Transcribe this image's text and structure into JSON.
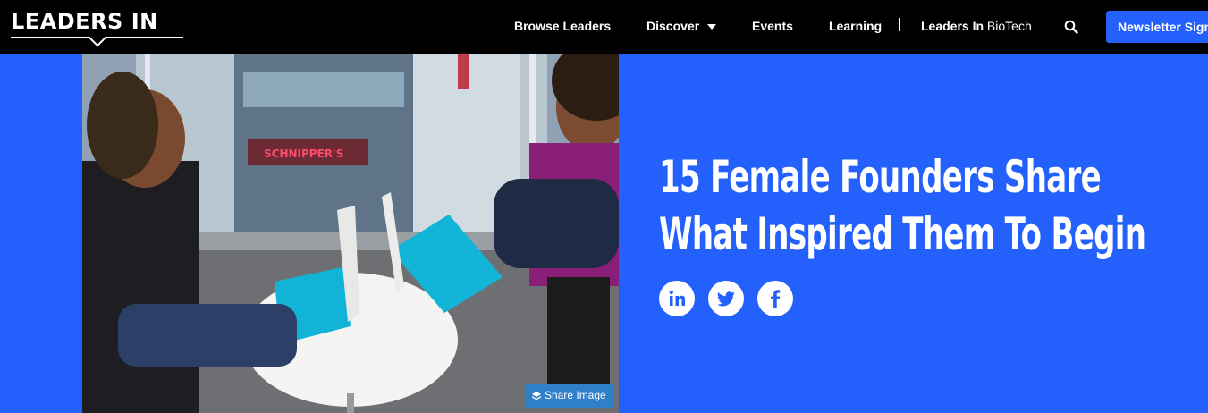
{
  "brand": {
    "logo_text": "LEADERS IN"
  },
  "nav": {
    "items": [
      {
        "label": "Browse Leaders"
      },
      {
        "label": "Discover",
        "icon": "chevron-down-icon"
      },
      {
        "label": "Events"
      },
      {
        "label": "Learning"
      }
    ],
    "biotech": {
      "bold": "Leaders In",
      "light": "BioTech"
    },
    "search_icon": "search-icon",
    "newsletter_label": "Newsletter Signup"
  },
  "hero": {
    "share_image_label": "Share Image",
    "share_icon": "layers-icon",
    "headline": "15 Female Founders Share What Inspired Them To Begin",
    "social": [
      "linkedin-icon",
      "twitter-icon",
      "facebook-icon"
    ],
    "photo_sign": "SCHNIPPER'S"
  },
  "colors": {
    "background": "#2460fb",
    "topbar": "#000000",
    "button": "#2460fb",
    "share": "#2f7fc9"
  }
}
